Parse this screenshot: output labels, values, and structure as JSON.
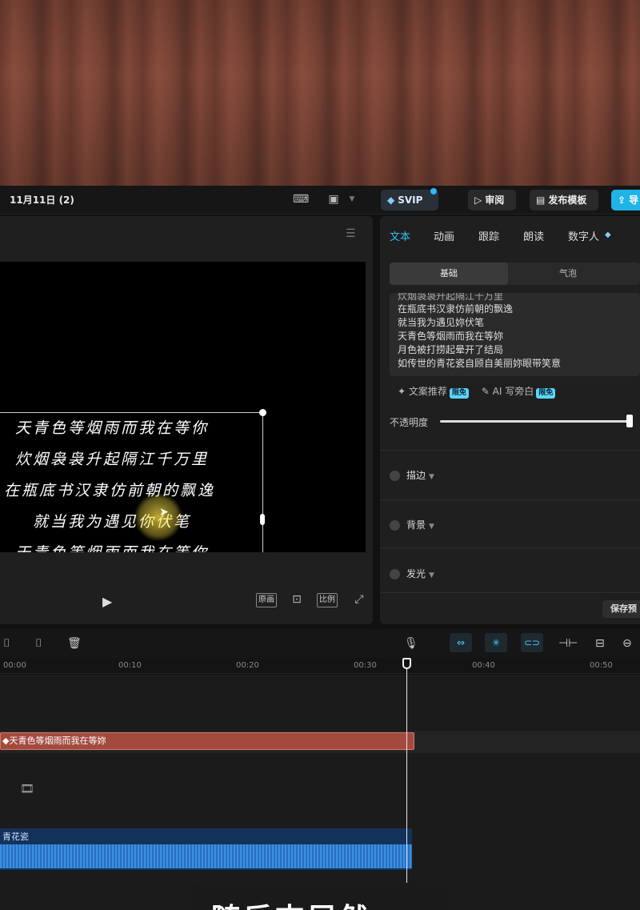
{
  "topbar": {
    "title": "11月11日 (2)",
    "svip_label": "SVIP",
    "review_label": "审阅",
    "publish_label": "发布模板",
    "export_label": "导"
  },
  "preview": {
    "lyrics": [
      "天青色等烟雨而我在等你",
      "炊烟袅袅升起隔江千万里",
      "在瓶底书汉隶仿前朝的飘逸",
      "就当我为遇见你伏笔",
      "天青色等烟雨而我在等你"
    ],
    "controls": {
      "original": "原画",
      "ratio": "比例"
    }
  },
  "inspector": {
    "tabs": [
      "文本",
      "动画",
      "跟踪",
      "朗读",
      "数字人"
    ],
    "subtabs": [
      "基础",
      "气泡"
    ],
    "text_lines": [
      "炊烟袅袅升起隔江千万里",
      "在瓶底书汉隶仿前朝的飘逸",
      "就当我为遇见妳伏笔",
      "天青色等烟雨而我在等妳",
      "月色被打捞起晕开了结局",
      "如传世的青花瓷自顾自美丽妳眼带笑意"
    ],
    "ai_copy": "文案推荐",
    "ai_narration": "AI 写旁白",
    "badge": "限免",
    "opacity_label": "不透明度",
    "opacity_value": 0.97,
    "options": [
      "描边",
      "背景",
      "发光"
    ],
    "save_preset": "保存预"
  },
  "timeline": {
    "ticks": [
      "00:00",
      "00:10",
      "00:20",
      "00:30",
      "00:40",
      "00:50"
    ],
    "text_clip": "天青色等烟雨而我在等妳",
    "audio_clip": "青花瓷"
  },
  "subtitle": "随后志居然"
}
